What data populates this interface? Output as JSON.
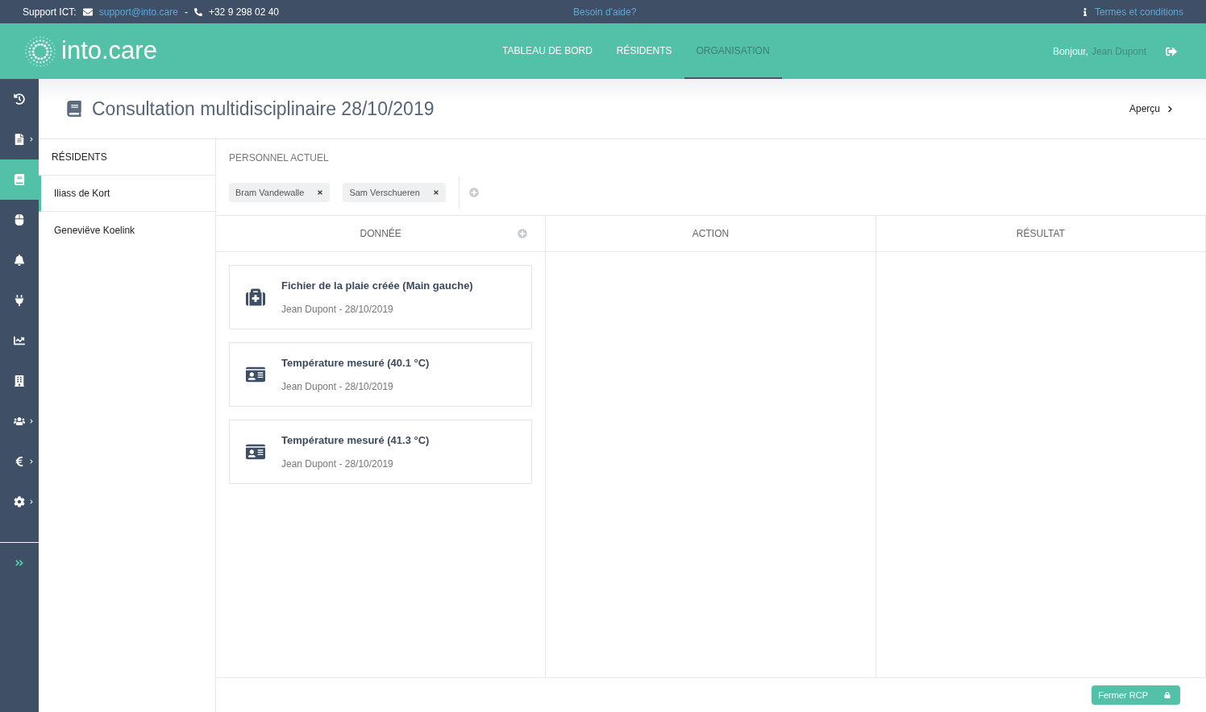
{
  "top_bar": {
    "label": "Support ICT:",
    "email": "support@into.care",
    "separator": "-",
    "phone": "+32 9 298 02 40",
    "help": "Besoin d'aide?",
    "terms": "Termes et conditions"
  },
  "header": {
    "logo": "into.care",
    "nav": [
      {
        "label": "TABLEAU DE BORD",
        "selected": false
      },
      {
        "label": "RÉSIDENTS",
        "selected": false
      },
      {
        "label": "ORGANISATION",
        "selected": true
      }
    ],
    "greeting": "Bonjour,",
    "user": "Jean Dupont"
  },
  "sidebar": {
    "items": [
      {
        "kind": "history",
        "selected": false,
        "expandable": false
      },
      {
        "kind": "document",
        "selected": false,
        "expandable": true
      },
      {
        "kind": "book",
        "selected": true,
        "expandable": false
      },
      {
        "kind": "mouse",
        "selected": false,
        "expandable": false
      },
      {
        "kind": "bell",
        "selected": false,
        "expandable": false
      },
      {
        "kind": "plug",
        "selected": false,
        "expandable": false
      },
      {
        "kind": "chart",
        "selected": false,
        "expandable": false
      },
      {
        "kind": "building",
        "selected": false,
        "expandable": false
      },
      {
        "kind": "users",
        "selected": false,
        "expandable": true
      },
      {
        "kind": "euro",
        "selected": false,
        "expandable": true
      },
      {
        "kind": "settings",
        "selected": false,
        "expandable": true
      }
    ]
  },
  "page": {
    "title": "Consultation multidisciplinaire 28/10/2019",
    "preview": "Aperçu"
  },
  "residents": {
    "heading": "RÉSIDENTS",
    "items": [
      {
        "name": "Iliass de Kort",
        "selected": true
      },
      {
        "name": "Geneviëve Koelink",
        "selected": false
      }
    ]
  },
  "staff": {
    "heading": "PERSONNEL ACTUEL",
    "members": [
      "Bram Vandewalle",
      "Sam Verschueren"
    ]
  },
  "columns": [
    {
      "title": "DONNÉE",
      "addable": true,
      "cards": [
        {
          "kind": "wound",
          "title": "Fichier de la plaie créée (Main gauche)",
          "meta": "Jean Dupont - 28/10/2019"
        },
        {
          "kind": "measurement",
          "title": "Température mesuré (40.1 °C)",
          "meta": "Jean Dupont - 28/10/2019"
        },
        {
          "kind": "measurement",
          "title": "Température mesuré (41.3 °C)",
          "meta": "Jean Dupont - 28/10/2019"
        }
      ]
    },
    {
      "title": "ACTION",
      "addable": false
    },
    {
      "title": "RÉSULTAT",
      "addable": false
    }
  ],
  "footer": {
    "close_button": "Fermer RCP"
  }
}
